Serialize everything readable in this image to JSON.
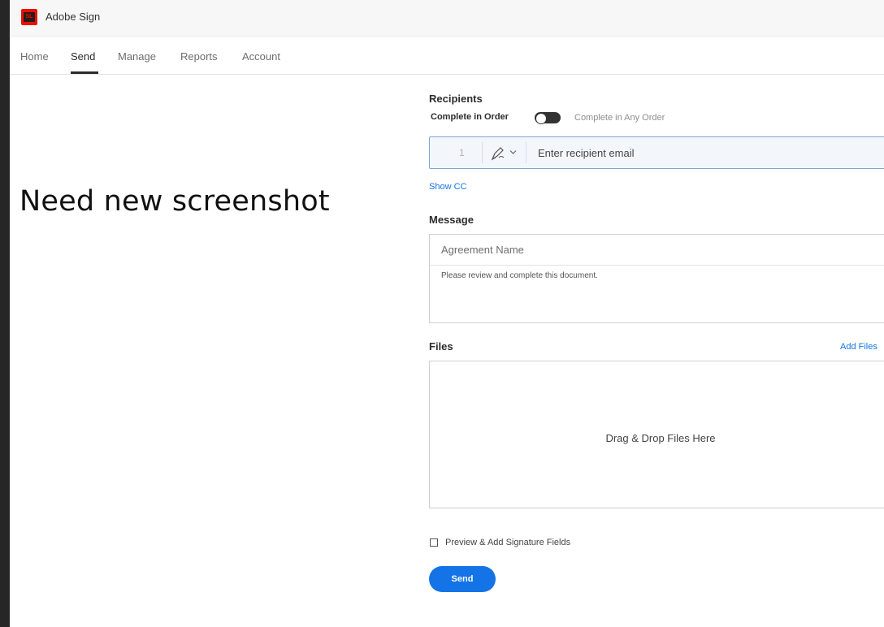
{
  "app": {
    "title": "Adobe Sign",
    "logo_text": "SL",
    "brand_color": "#eb1000"
  },
  "nav": {
    "tabs": [
      {
        "label": "Home",
        "active": false
      },
      {
        "label": "Send",
        "active": true
      },
      {
        "label": "Manage",
        "active": false
      },
      {
        "label": "Reports",
        "active": false
      },
      {
        "label": "Account",
        "active": false
      }
    ]
  },
  "note": "Need new screenshot",
  "recipients": {
    "title": "Recipients",
    "order_label": "Complete in Order",
    "any_order_label": "Complete in Any Order",
    "row_number": "1",
    "signer_icon": "pen-icon",
    "email_placeholder": "Enter recipient email",
    "show_cc": "Show CC"
  },
  "message": {
    "title": "Message",
    "agreement_name_placeholder": "Agreement Name",
    "body": "Please review and complete this document."
  },
  "files": {
    "title": "Files",
    "add_files": "Add Files",
    "drop_label": "Drag & Drop Files Here"
  },
  "preview": {
    "label": "Preview & Add Signature Fields",
    "checked": false
  },
  "send_button": "Send",
  "accent_color": "#1473e6"
}
